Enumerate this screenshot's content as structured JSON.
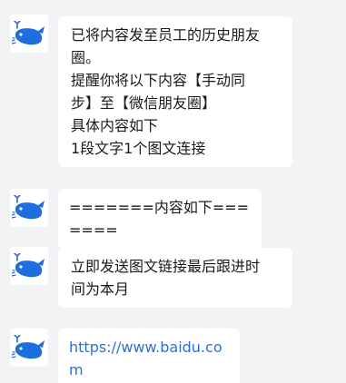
{
  "messages": [
    {
      "lines": [
        "已将内容发至员工的历史朋友",
        "圈。",
        "提醒你将以下内容【手动同",
        "步】至【微信朋友圈】",
        "具体内容如下",
        "1段文字1个图文连接"
      ]
    },
    {
      "lines": [
        "=======内容如下======="
      ]
    },
    {
      "lines": [
        "立即发送图文链接最后跟进时",
        "间为本月"
      ]
    },
    {
      "lines": [
        "https://www.baidu.com"
      ]
    }
  ],
  "avatar_icon": "whale-icon",
  "colors": {
    "background": "#f2f3f5",
    "bubble": "#ffffff",
    "link": "#2f6fd6",
    "whale_blue": "#1d6fe0"
  }
}
